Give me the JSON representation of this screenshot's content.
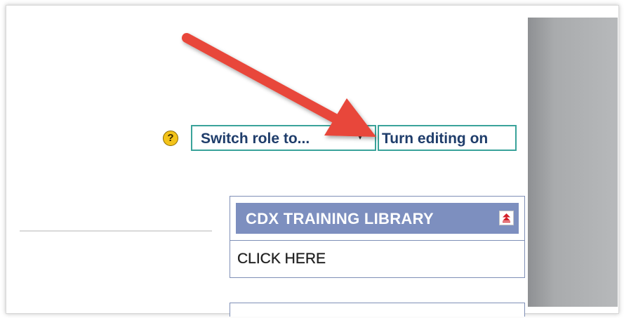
{
  "header": {
    "help_icon": "?",
    "role_switch": {
      "label": "Switch role to...",
      "caret": "▾"
    },
    "edit_toggle": {
      "label": "Turn editing on"
    }
  },
  "blocks": [
    {
      "title": "CDX TRAINING LIBRARY",
      "collapse_icon": "collapse-up-icon",
      "link": "CLICK HERE"
    }
  ],
  "annotation": {
    "color": "#e8473a"
  },
  "colors": {
    "accent_border": "#3aa39a",
    "block_header": "#7d8fbf",
    "link_text": "#1f3d6b",
    "help_icon": "#f3c31a"
  }
}
